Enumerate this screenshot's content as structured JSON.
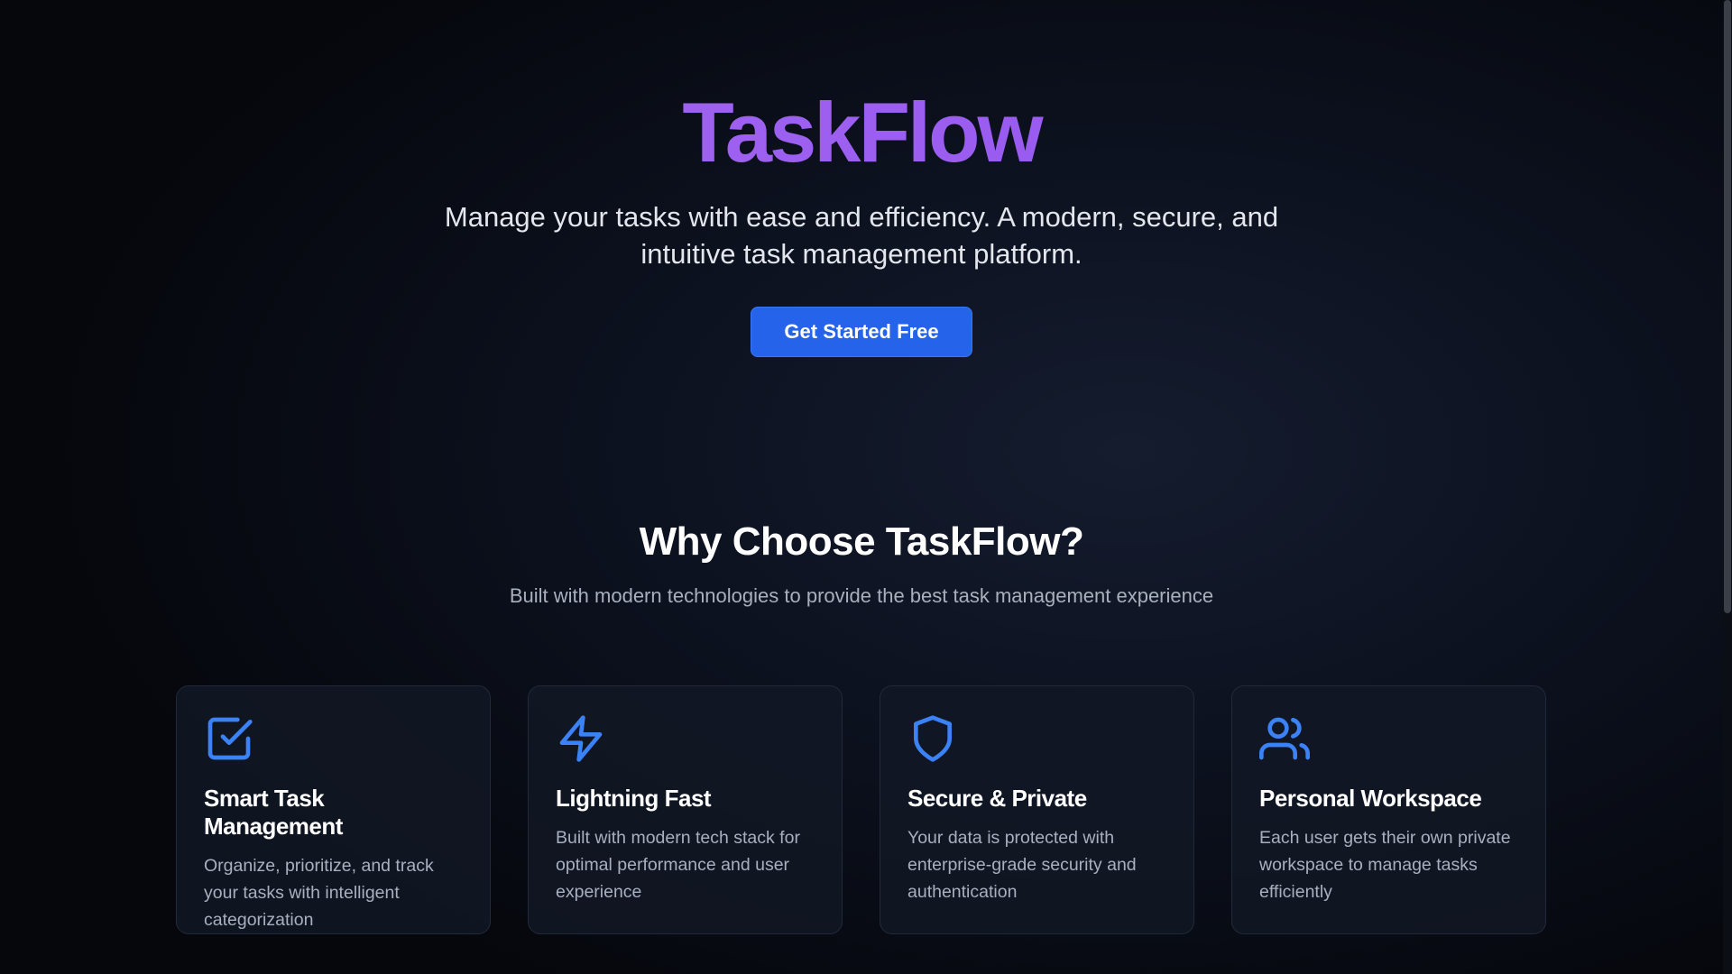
{
  "hero": {
    "brand": "TaskFlow",
    "tagline": "Manage your tasks with ease and efficiency. A modern, secure, and intuitive task management platform.",
    "cta_label": "Get Started Free"
  },
  "features": {
    "title": "Why Choose TaskFlow?",
    "subtitle": "Built with modern technologies to provide the best task management experience",
    "cards": [
      {
        "icon": "checkbox-icon",
        "title": "Smart Task Management",
        "description": "Organize, prioritize, and track your tasks with intelligent categorization"
      },
      {
        "icon": "lightning-icon",
        "title": "Lightning Fast",
        "description": "Built with modern tech stack for optimal performance and user experience"
      },
      {
        "icon": "shield-icon",
        "title": "Secure & Private",
        "description": "Your data is protected with enterprise-grade security and authentication"
      },
      {
        "icon": "users-icon",
        "title": "Personal Workspace",
        "description": "Each user gets their own private workspace to manage tasks efficiently"
      }
    ]
  },
  "colors": {
    "brand_gradient": "#9a5cf0",
    "accent": "#2563eb",
    "icon": "#3b82f6",
    "background": "#0d1220"
  }
}
